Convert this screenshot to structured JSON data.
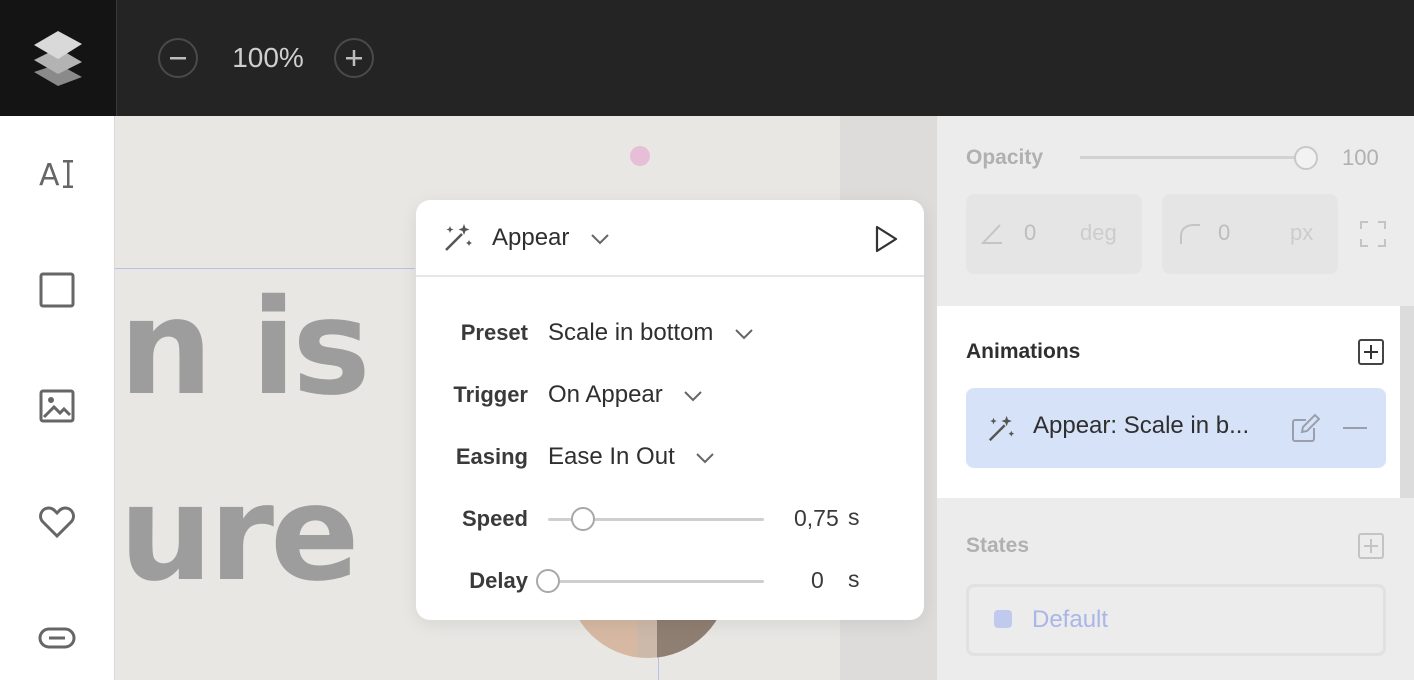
{
  "toolbar": {
    "zoom_level": "100%"
  },
  "popup": {
    "animation_type": "Appear",
    "preset_label": "Preset",
    "preset_value": "Scale in bottom",
    "trigger_label": "Trigger",
    "trigger_value": "On Appear",
    "easing_label": "Easing",
    "easing_value": "Ease In Out",
    "speed_label": "Speed",
    "speed_value": "0,75",
    "speed_unit": "s",
    "speed_fraction": 0.16,
    "delay_label": "Delay",
    "delay_value": "0",
    "delay_unit": "s",
    "delay_fraction": 0.0
  },
  "canvas": {
    "headline_line1": "n is",
    "headline_line2": "ure"
  },
  "panel": {
    "opacity_label": "Opacity",
    "opacity_value": "100",
    "rotation_value": "0",
    "rotation_unit": "deg",
    "radius_value": "0",
    "radius_unit": "px",
    "animations_title": "Animations",
    "animation_item_label": "Appear: Scale in b...",
    "states_title": "States",
    "state_default": "Default"
  },
  "colors": {
    "topbar": "#242424",
    "selection_blue": "#d6e2f8",
    "headline_gray": "#9d9d9d"
  }
}
